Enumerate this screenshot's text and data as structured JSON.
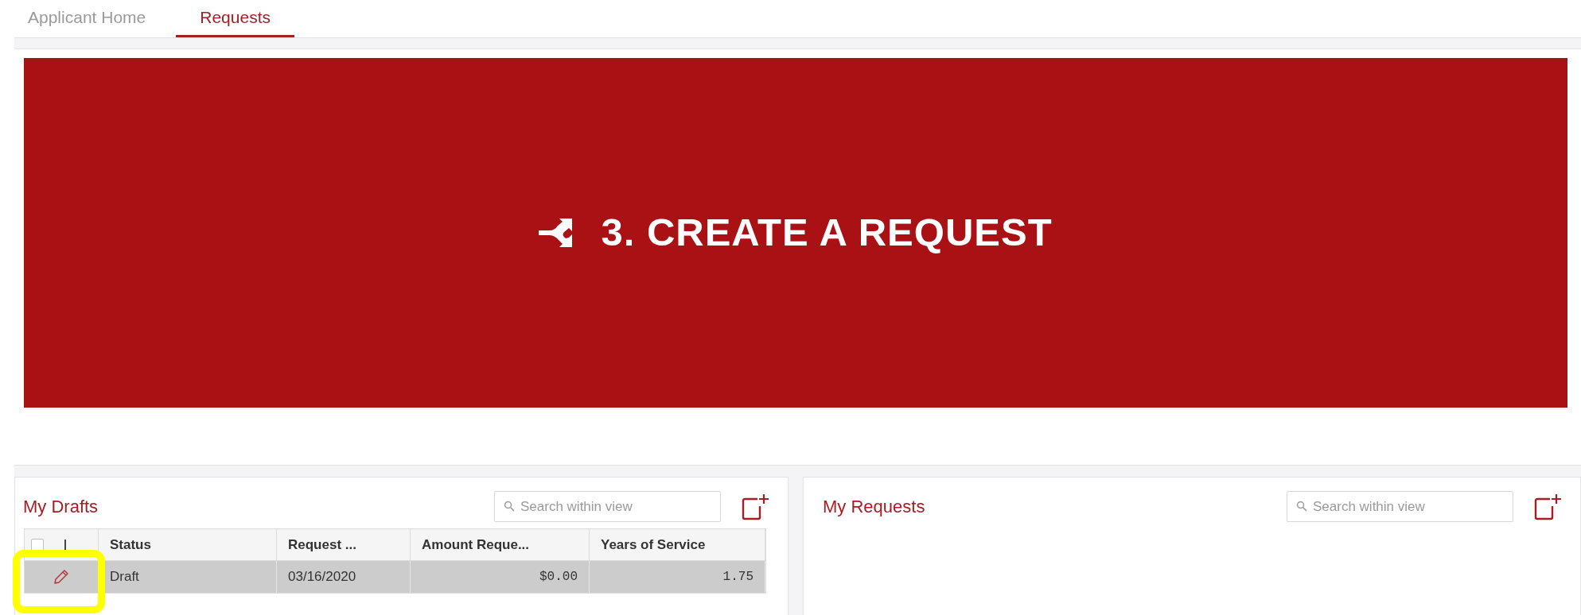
{
  "tabs": [
    {
      "label": "Applicant Home",
      "selected": false
    },
    {
      "label": "Requests",
      "selected": true
    }
  ],
  "banner": {
    "title": "3. CREATE A REQUEST"
  },
  "panels": [
    {
      "title": "My Drafts",
      "search": {
        "placeholder": "Search within view"
      },
      "table": {
        "header_checkbox": {
          "checked": false
        },
        "columns": [
          "Status",
          "Request ...",
          "Amount Reque...",
          "Years of Service"
        ],
        "rows": [
          {
            "selected": true,
            "cells": [
              "Draft",
              "03/16/2020",
              "$0.00",
              "1.75"
            ]
          }
        ]
      }
    },
    {
      "title": "My Requests",
      "search": {
        "placeholder": "Search within view"
      }
    }
  ]
}
